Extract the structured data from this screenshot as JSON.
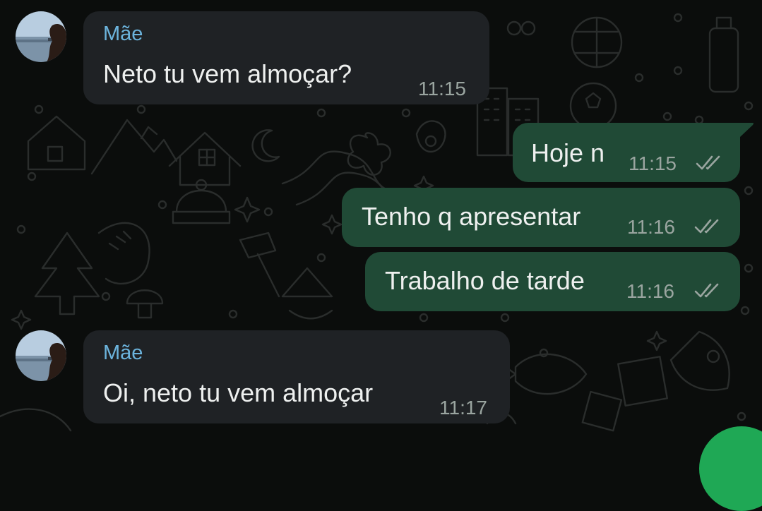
{
  "colors": {
    "background": "#0b0d0c",
    "incoming_bubble": "#1f2225",
    "outgoing_bubble": "#204a36",
    "sender_name": "#6cb4dd",
    "message_text": "#eef0ef",
    "timestamp": "#9aa5a0",
    "fab_green": "#1fa855"
  },
  "messages": [
    {
      "direction": "incoming",
      "sender": "Mãe",
      "text": "Neto tu vem almoçar?",
      "time": "11:15"
    },
    {
      "direction": "outgoing",
      "text": "Hoje n",
      "time": "11:15",
      "status": "read-double-check-icon"
    },
    {
      "direction": "outgoing",
      "text": "Tenho q apresentar",
      "time": "11:16",
      "status": "read-double-check-icon"
    },
    {
      "direction": "outgoing",
      "text": "Trabalho de tarde",
      "time": "11:16",
      "status": "read-double-check-icon"
    },
    {
      "direction": "incoming",
      "sender": "Mãe",
      "text": "Oi, neto tu vem almoçar",
      "time": "11:17"
    }
  ]
}
